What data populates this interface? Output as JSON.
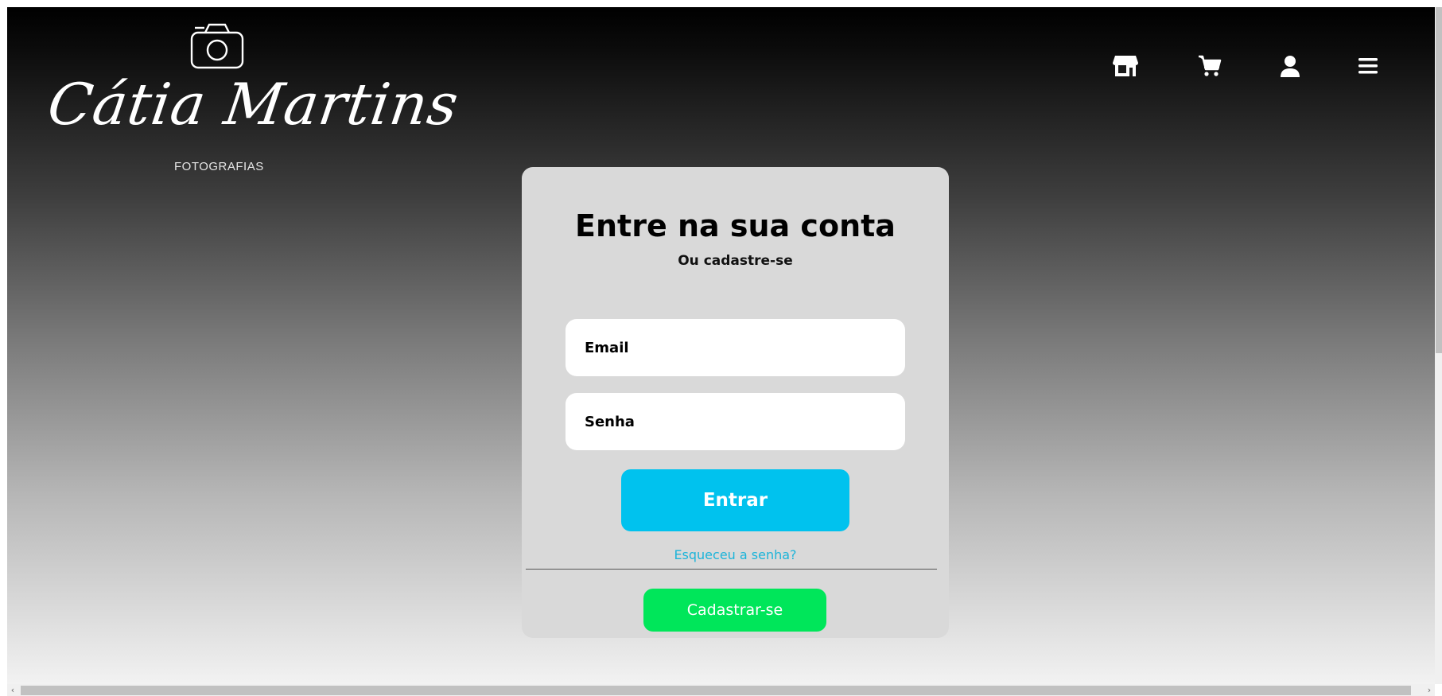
{
  "logo": {
    "script_text": "Cátia Martins",
    "subtitle": "FOTOGRAFIAS",
    "icon": "camera-icon"
  },
  "nav": {
    "items": [
      {
        "icon": "store-icon",
        "label": "Loja"
      },
      {
        "icon": "cart-icon",
        "label": "Carrinho"
      },
      {
        "icon": "user-icon",
        "label": "Conta"
      },
      {
        "icon": "menu-icon",
        "label": "Menu"
      }
    ]
  },
  "login": {
    "title": "Entre na sua conta",
    "subtitle": "Ou cadastre-se",
    "email_label": "Email",
    "password_label": "Senha",
    "submit_label": "Entrar",
    "forgot_label": "Esqueceu a senha?",
    "register_label": "Cadastrar-se"
  },
  "colors": {
    "primary_button": "#00c2ee",
    "register_button": "#00e65a",
    "forgot_link": "#1cb4d9",
    "card_background": "#d9d9d9"
  },
  "scrollbar": {
    "left_arrow": "‹",
    "right_arrow": "›"
  }
}
